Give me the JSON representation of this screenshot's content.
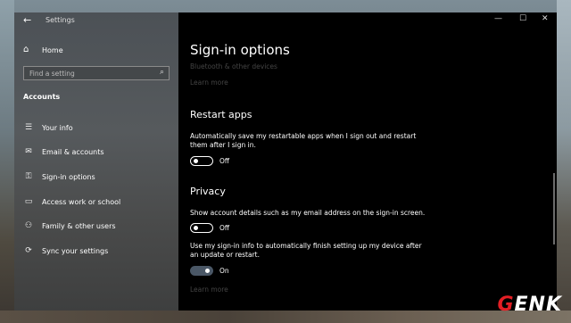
{
  "window": {
    "app_title": "Settings",
    "controls": {
      "minimize": "—",
      "maximize": "☐",
      "close": "✕"
    }
  },
  "sidebar": {
    "home_label": "Home",
    "search_placeholder": "Find a setting",
    "section_title": "Accounts",
    "items": [
      {
        "label": "Your info",
        "icon": "person-card-icon"
      },
      {
        "label": "Email & accounts",
        "icon": "mail-icon"
      },
      {
        "label": "Sign-in options",
        "icon": "key-icon"
      },
      {
        "label": "Access work or school",
        "icon": "briefcase-icon"
      },
      {
        "label": "Family & other users",
        "icon": "people-icon"
      },
      {
        "label": "Sync your settings",
        "icon": "sync-icon"
      }
    ]
  },
  "main": {
    "page_title": "Sign-in options",
    "top_link": "Bluetooth & other devices",
    "learn_more_top": "Learn more",
    "restart": {
      "title": "Restart apps",
      "description": "Automatically save my restartable apps when I sign out and restart them after I sign in.",
      "state": "Off"
    },
    "privacy": {
      "title": "Privacy",
      "desc1": "Show account details such as my email address on the sign-in screen.",
      "state1": "Off",
      "desc2": "Use my sign-in info to automatically finish setting up my device after an update or restart.",
      "state2": "On",
      "learn_more": "Learn more"
    }
  },
  "watermark": {
    "first": "G",
    "rest": "ENK"
  }
}
